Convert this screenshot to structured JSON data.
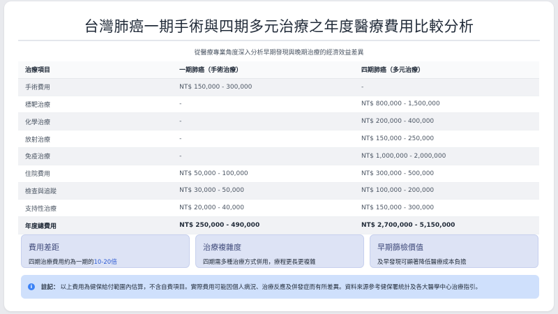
{
  "title": "台灣肺癌一期手術與四期多元治療之年度醫療費用比較分析",
  "subtitle": "從醫療專業角度深入分析早期發現與晚期治療的經濟效益差異",
  "table": {
    "headers": [
      "治療項目",
      "一期肺癌（手術治療）",
      "四期肺癌（多元治療）"
    ],
    "rows": [
      [
        "手術費用",
        "NT$ 150,000 - 300,000",
        "-"
      ],
      [
        "標靶治療",
        "-",
        "NT$ 800,000 - 1,500,000"
      ],
      [
        "化學治療",
        "-",
        "NT$ 200,000 - 400,000"
      ],
      [
        "放射治療",
        "-",
        "NT$ 150,000 - 250,000"
      ],
      [
        "免疫治療",
        "-",
        "NT$ 1,000,000 - 2,000,000"
      ],
      [
        "住院費用",
        "NT$ 50,000 - 100,000",
        "NT$ 300,000 - 500,000"
      ],
      [
        "檢查與追蹤",
        "NT$ 30,000 - 50,000",
        "NT$ 100,000 - 200,000"
      ],
      [
        "支持性治療",
        "NT$ 20,000 - 40,000",
        "NT$ 150,000 - 300,000"
      ]
    ],
    "total": [
      "年度總費用",
      "NT$ 250,000 - 490,000",
      "NT$ 2,700,000 - 5,150,000"
    ]
  },
  "boxes": [
    {
      "title": "費用差距",
      "desc_prefix": "四期治療費用約為一期的",
      "desc_highlight": "10-20倍"
    },
    {
      "title": "治療複雜度",
      "desc": "四期需多種治療方式併用，療程更長更複雜"
    },
    {
      "title": "早期篩檢價值",
      "desc": "及早發現可顯著降低醫療成本負擔"
    }
  ],
  "note": {
    "icon": "i",
    "label": "註記：",
    "text": "以上費用為健保給付範圍內估算，不含自費項目。實際費用可能因個人病況、治療反應及併發症而有所差異。資料來源參考健保署統計及各大醫學中心治療指引。"
  },
  "colors": {
    "accent": "#2d5bd3",
    "box_bg": "#dde3f5",
    "note_bg": "#cfe0fc",
    "info_icon": "#3b82f6"
  }
}
